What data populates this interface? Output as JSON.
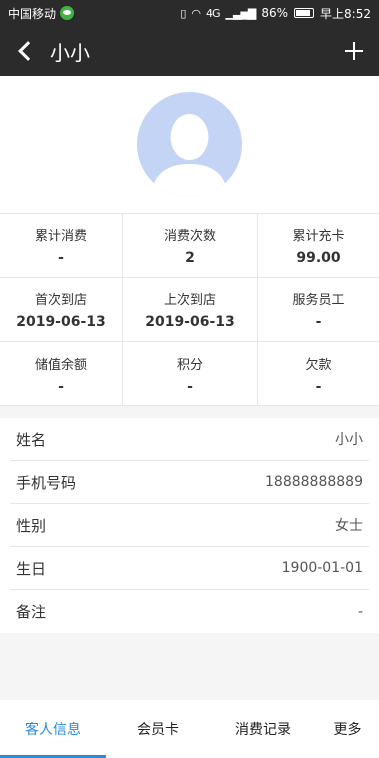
{
  "status_bar": {
    "carrier": "中国移动",
    "network": "4G",
    "battery": "86%",
    "time": "早上8:52"
  },
  "nav": {
    "title": "小小"
  },
  "stats": [
    {
      "label": "累计消费",
      "value": "-"
    },
    {
      "label": "消费次数",
      "value": "2"
    },
    {
      "label": "累计充卡",
      "value": "99.00"
    },
    {
      "label": "首次到店",
      "value": "2019-06-13"
    },
    {
      "label": "上次到店",
      "value": "2019-06-13"
    },
    {
      "label": "服务员工",
      "value": "-"
    },
    {
      "label": "储值余额",
      "value": "-"
    },
    {
      "label": "积分",
      "value": "-"
    },
    {
      "label": "欠款",
      "value": "-"
    }
  ],
  "info": [
    {
      "label": "姓名",
      "value": "小小"
    },
    {
      "label": "手机号码",
      "value": "18888888889"
    },
    {
      "label": "性别",
      "value": "女士"
    },
    {
      "label": "生日",
      "value": "1900-01-01"
    },
    {
      "label": "备注",
      "value": "-"
    }
  ],
  "tabs": [
    {
      "label": "客人信息",
      "active": true
    },
    {
      "label": "会员卡",
      "active": false
    },
    {
      "label": "消费记录",
      "active": false
    },
    {
      "label": "更多",
      "active": false
    }
  ],
  "colors": {
    "header_bg": "#2b2b2b",
    "accent": "#2a8bdb",
    "avatar_bg": "#c3d4f5"
  }
}
